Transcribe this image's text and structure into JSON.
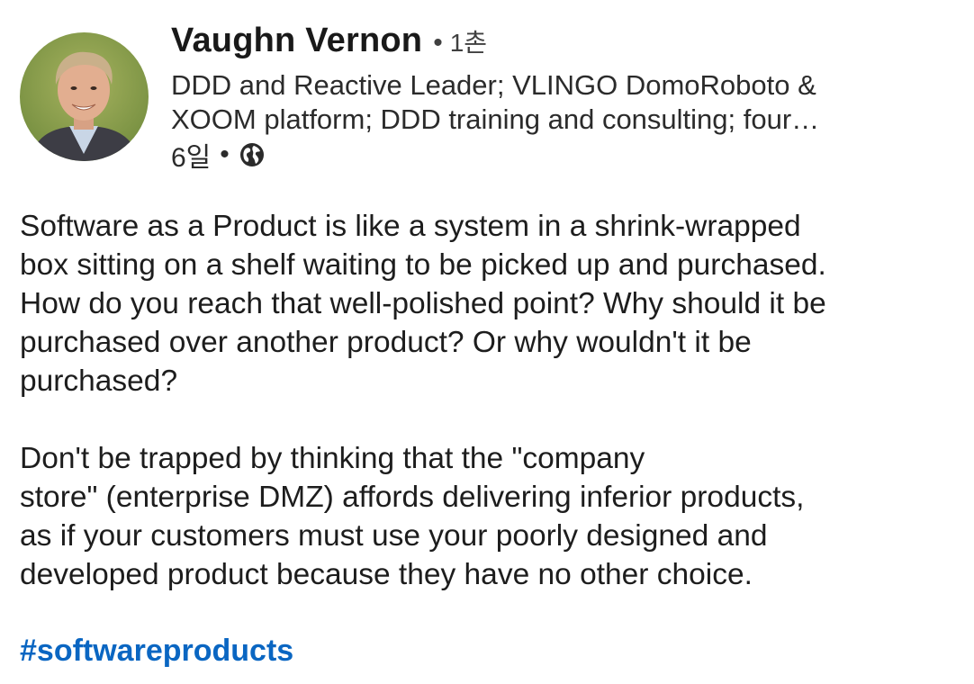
{
  "author": {
    "name": "Vaughn Vernon",
    "degree": "1촌",
    "headline_lines": [
      "DDD and Reactive Leader; VLINGO DomoRoboto &",
      "XOOM platform; DDD training and consulting; four…"
    ],
    "posted_ago": "6일",
    "visibility_icon": "globe-icon"
  },
  "post": {
    "paragraph1": [
      "Software as a Product is like a system in a shrink-wrapped",
      "box sitting on a shelf waiting to be picked up and purchased.",
      "How do you reach that well-polished point? Why should it be",
      "purchased over another product? Or why wouldn't it be",
      "purchased?"
    ],
    "paragraph2": [
      "Don't be trapped by thinking that the \"company",
      "store\" (enterprise DMZ) affords delivering inferior products,",
      "as if your customers must use your poorly designed and",
      "developed product because they have no other choice."
    ],
    "hashtag": "#softwareproducts"
  },
  "colors": {
    "hashtag": "#0a66c2",
    "text": "#191919",
    "avatar_bg": "#8a9a4a"
  }
}
